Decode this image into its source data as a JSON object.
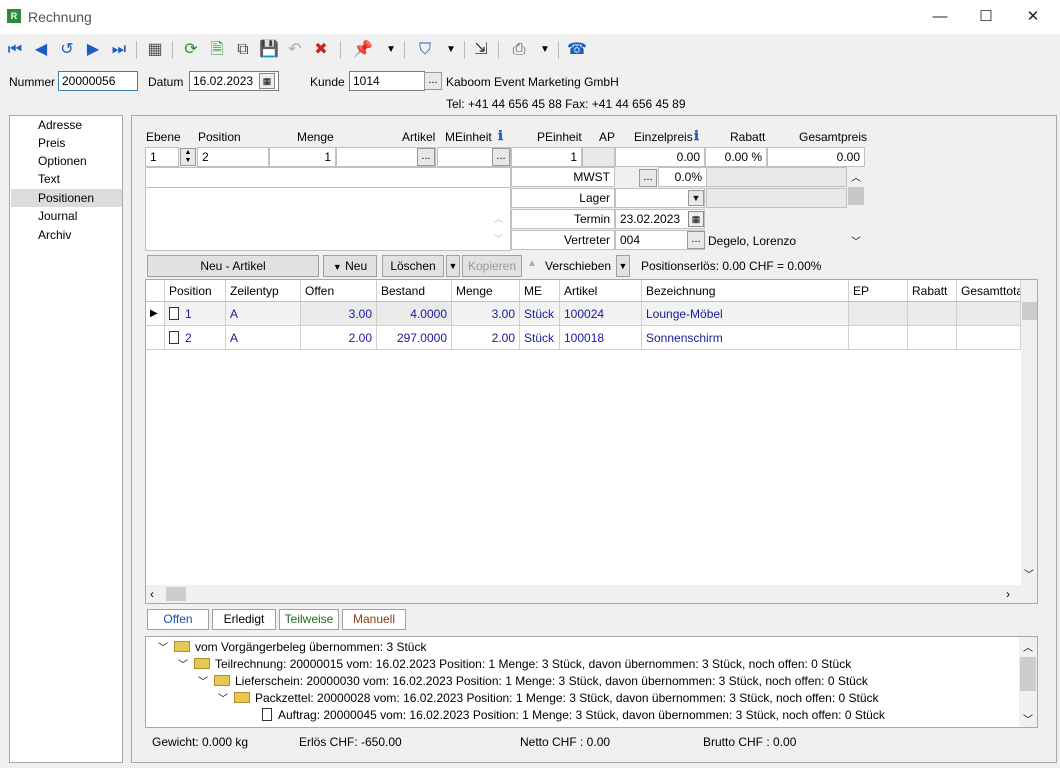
{
  "window": {
    "title": "Rechnung",
    "app_icon": "R",
    "minimize": "—",
    "maximize": "☐",
    "close": "✕"
  },
  "toolbar": {
    "icons": [
      "first-icon",
      "prev-icon",
      "undo-blue-icon",
      "next-icon",
      "last-icon",
      "table-icon",
      "refresh-icon",
      "new-doc-icon",
      "copy-icon",
      "save-icon",
      "undo-icon",
      "delete-icon",
      "pin-icon",
      "filter-icon",
      "goto-icon",
      "print-icon",
      "phone-icon"
    ]
  },
  "header": {
    "nummer_label": "Nummer",
    "nummer_value": "20000056",
    "datum_label": "Datum",
    "datum_value": "16.02.2023",
    "kunde_label": "Kunde",
    "kunde_value": "1014",
    "kunde_name": "Kaboom Event Marketing GmbH",
    "contact": "Tel: +41 44 656 45 88  Fax: +41 44 656 45 89",
    "dots": "..."
  },
  "nav": {
    "items": [
      "Adresse",
      "Preis",
      "Optionen",
      "Text",
      "Positionen",
      "Journal",
      "Archiv"
    ],
    "selected": "Positionen"
  },
  "position_form": {
    "headers": {
      "ebene": "Ebene",
      "position": "Position",
      "menge": "Menge",
      "artikel": "Artikel",
      "meinheit": "MEinheit",
      "peinheit": "PEinheit",
      "ap": "AP",
      "einzelpreis": "Einzelpreis",
      "rabatt": "Rabatt",
      "gesamtpreis": "Gesamtpreis"
    },
    "values": {
      "ebene": "1",
      "position": "2",
      "menge": "1",
      "peinheit": "1",
      "einzelpreis": "0.00",
      "rabatt": "0.00 %",
      "gesamtpreis": "0.00"
    },
    "mwst_label": "MWST",
    "mwst_value": "0.0%",
    "lager_label": "Lager",
    "termin_label": "Termin",
    "termin_value": "23.02.2023",
    "vertreter_label": "Vertreter",
    "vertreter_value": "004",
    "vertreter_name": "Degelo, Lorenzo"
  },
  "actions": {
    "neu_artikel": "Neu - Artikel",
    "neu": "Neu",
    "loeschen": "Löschen",
    "kopieren": "Kopieren",
    "verschieben": "Verschieben",
    "positionserloes": "Positionserlös:  0.00 CHF = 0.00%"
  },
  "grid": {
    "columns": [
      "Position",
      "Zeilentyp",
      "Offen",
      "Bestand",
      "Menge",
      "ME",
      "Artikel",
      "Bezeichnung",
      "EP",
      "Rabatt",
      "Gesamttota"
    ],
    "rows": [
      {
        "position": "1",
        "zeilentyp": "A",
        "offen": "3.00",
        "bestand": "4.0000",
        "menge": "3.00",
        "me": "Stück",
        "artikel": "100024",
        "bezeichnung": "Lounge-Möbel"
      },
      {
        "position": "2",
        "zeilentyp": "A",
        "offen": "2.00",
        "bestand": "297.0000",
        "menge": "2.00",
        "me": "Stück",
        "artikel": "100018",
        "bezeichnung": "Sonnenschirm"
      }
    ]
  },
  "tabs": [
    "Offen",
    "Erledigt",
    "Teilweise",
    "Manuell"
  ],
  "tree": [
    "vom Vorgängerbeleg übernommen: 3 Stück",
    "Teilrechnung: 20000015 vom: 16.02.2023 Position: 1 Menge: 3 Stück, davon übernommen: 3 Stück, noch offen: 0 Stück",
    "Lieferschein: 20000030 vom: 16.02.2023 Position: 1 Menge: 3 Stück, davon übernommen: 3 Stück, noch offen: 0 Stück",
    "Packzettel: 20000028 vom: 16.02.2023 Position: 1 Menge: 3 Stück, davon übernommen: 3 Stück, noch offen: 0 Stück",
    "Auftrag: 20000045 vom: 16.02.2023 Position: 1 Menge: 3 Stück, davon übernommen: 3 Stück, noch offen: 0 Stück"
  ],
  "footer": {
    "gewicht": "Gewicht:  0.000 kg",
    "erloes": "Erlös CHF:  -650.00",
    "netto": "Netto CHF :  0.00",
    "brutto": "Brutto CHF :  0.00"
  },
  "colors": {
    "accent": "#1a5fbf",
    "grid_text": "#1a1a9a"
  }
}
